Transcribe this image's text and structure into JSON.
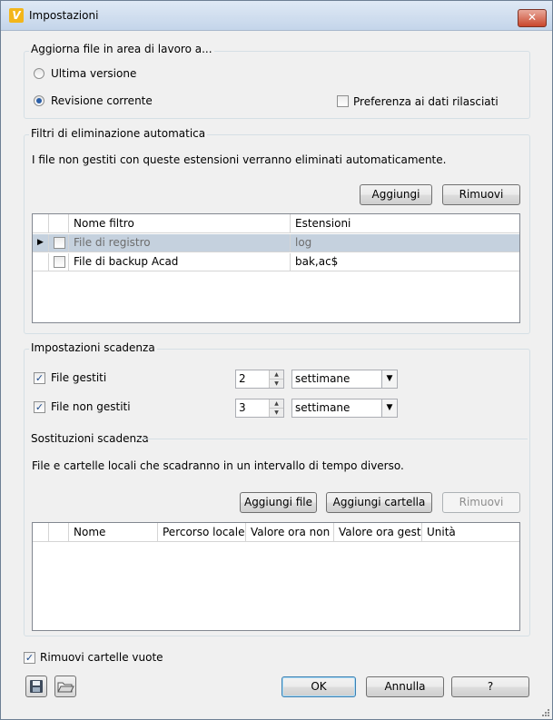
{
  "window": {
    "title": "Impostazioni",
    "close_glyph": "✕",
    "app_icon_letter": "V"
  },
  "update_group": {
    "label": "Aggiorna file in area di lavoro a...",
    "latest_version": "Ultima versione",
    "current_revision": "Revisione corrente",
    "selected": "current_revision",
    "prefer_released": "Preferenza ai dati rilasciati",
    "prefer_released_checked": false
  },
  "cleanup_group": {
    "label": "Filtri di eliminazione automatica",
    "description": "I file non gestiti con queste estensioni verranno eliminati automaticamente.",
    "add_button": "Aggiungi",
    "remove_button": "Rimuovi",
    "columns": [
      "Nome filtro",
      "Estensioni"
    ],
    "rows": [
      {
        "name": "File di registro",
        "extensions": "log",
        "checked": false,
        "selected": true
      },
      {
        "name": "File di backup Acad",
        "extensions": "bak,ac$",
        "checked": false,
        "selected": false
      }
    ]
  },
  "expiry_group": {
    "label": "Impostazioni scadenza",
    "managed": {
      "label": "File gestiti",
      "checked": true,
      "value": "2",
      "unit": "settimane"
    },
    "unmanaged": {
      "label": "File non gestiti",
      "checked": true,
      "value": "3",
      "unit": "settimane"
    }
  },
  "overrides_group": {
    "label": "Sostituzioni scadenza",
    "description": "File e cartelle locali che scadranno in un intervallo di tempo diverso.",
    "add_file_button": "Aggiungi file",
    "add_folder_button": "Aggiungi cartella",
    "remove_button": "Rimuovi",
    "columns": [
      "Nome",
      "Percorso locale",
      "Valore ora non ...",
      "Valore ora gest...",
      "Unità"
    ]
  },
  "remove_empty_folders": {
    "label": "Rimuovi cartelle vuote",
    "checked": true
  },
  "footer": {
    "ok": "OK",
    "cancel": "Annulla",
    "help": "?"
  },
  "icons": {
    "save": "save-icon",
    "open": "folder-open-icon"
  },
  "colors": {
    "selected_row": "#c5d1de",
    "accent": "#2b5fa8",
    "titlebar": "#c4d5ea"
  }
}
